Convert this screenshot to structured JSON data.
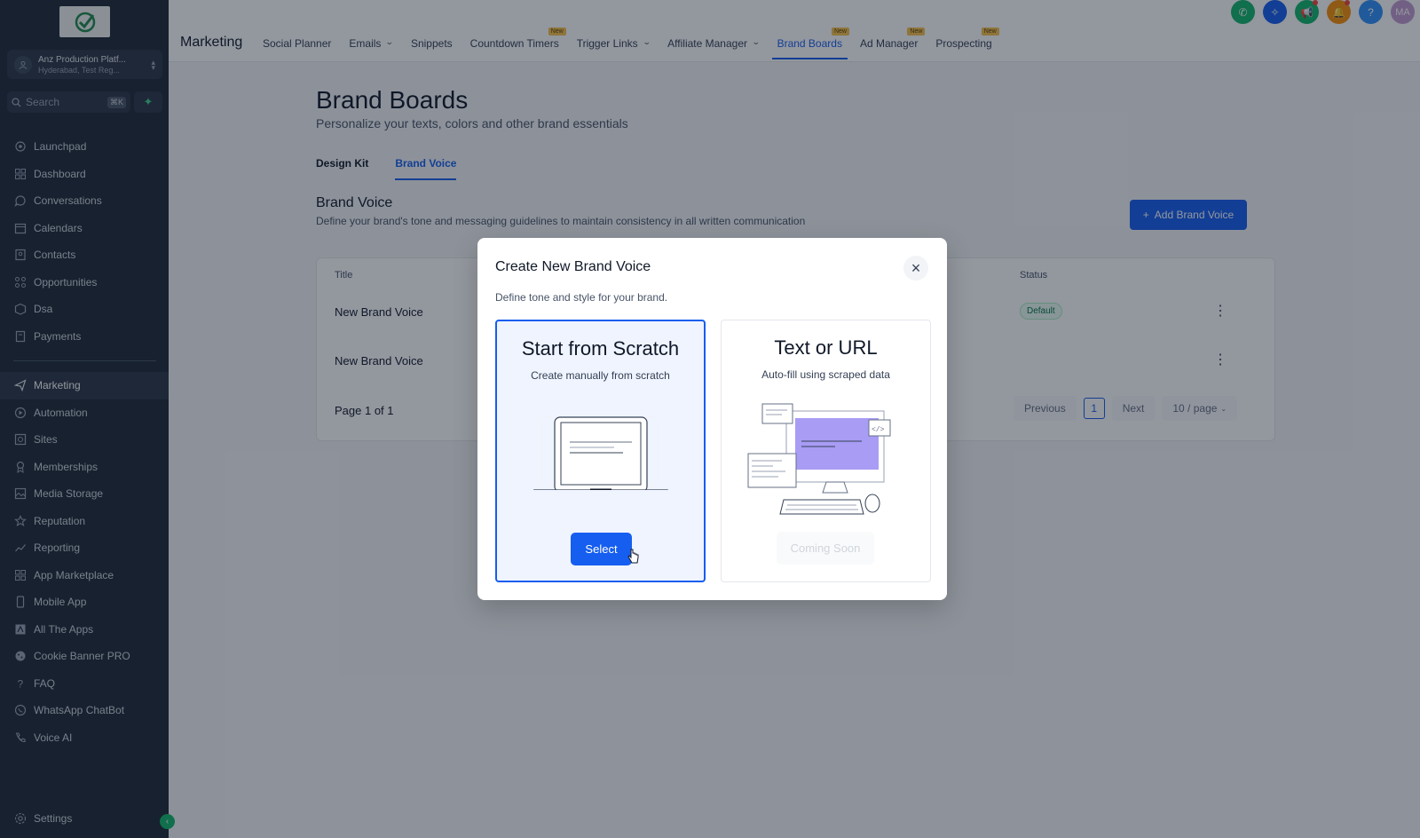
{
  "sidebar": {
    "account": {
      "name": "Anz Production Platf...",
      "location": "Hyderabad, Test Reg..."
    },
    "search": {
      "placeholder": "Search",
      "shortcut": "⌘K"
    },
    "items": [
      {
        "label": "Launchpad",
        "icon": "rocket-icon"
      },
      {
        "label": "Dashboard",
        "icon": "grid-icon"
      },
      {
        "label": "Conversations",
        "icon": "chat-icon"
      },
      {
        "label": "Calendars",
        "icon": "calendar-icon"
      },
      {
        "label": "Contacts",
        "icon": "contacts-icon"
      },
      {
        "label": "Opportunities",
        "icon": "opportunities-icon"
      },
      {
        "label": "Dsa",
        "icon": "box-icon"
      },
      {
        "label": "Payments",
        "icon": "payments-icon"
      }
    ],
    "items2": [
      {
        "label": "Marketing",
        "icon": "send-icon",
        "active": true
      },
      {
        "label": "Automation",
        "icon": "automation-icon"
      },
      {
        "label": "Sites",
        "icon": "sites-icon"
      },
      {
        "label": "Memberships",
        "icon": "memberships-icon"
      },
      {
        "label": "Media Storage",
        "icon": "image-icon"
      },
      {
        "label": "Reputation",
        "icon": "star-icon"
      },
      {
        "label": "Reporting",
        "icon": "chart-icon"
      },
      {
        "label": "App Marketplace",
        "icon": "apps-icon"
      },
      {
        "label": "Mobile App",
        "icon": "mobile-icon"
      },
      {
        "label": "All The Apps",
        "icon": "allapps-icon"
      },
      {
        "label": "Cookie Banner PRO",
        "icon": "cookie-icon"
      },
      {
        "label": "FAQ",
        "icon": "question-icon"
      },
      {
        "label": "WhatsApp ChatBot",
        "icon": "whatsapp-icon"
      },
      {
        "label": "Voice AI",
        "icon": "phone-icon"
      }
    ],
    "settings_label": "Settings"
  },
  "topbar": {
    "title": "Marketing",
    "tabs": [
      {
        "label": "Social Planner"
      },
      {
        "label": "Emails",
        "dropdown": true
      },
      {
        "label": "Snippets"
      },
      {
        "label": "Countdown Timers",
        "badge": "New"
      },
      {
        "label": "Trigger Links",
        "dropdown": true
      },
      {
        "label": "Affiliate Manager",
        "dropdown": true
      },
      {
        "label": "Brand Boards",
        "badge": "New",
        "active": true
      },
      {
        "label": "Ad Manager",
        "badge": "New"
      },
      {
        "label": "Prospecting",
        "badge": "New"
      }
    ],
    "icons": [
      {
        "name": "phone-icon",
        "color": "#12b76a"
      },
      {
        "name": "ai-sparkle-icon",
        "color": "#155eef"
      },
      {
        "name": "megaphone-icon",
        "color": "#12b76a"
      },
      {
        "name": "bell-icon",
        "color": "#f79009"
      },
      {
        "name": "help-icon",
        "color": "#2e90fa"
      }
    ],
    "avatar_initials": "MA"
  },
  "page": {
    "title": "Brand Boards",
    "subtitle": "Personalize your texts, colors and other brand essentials",
    "tabs": [
      {
        "label": "Design Kit"
      },
      {
        "label": "Brand Voice",
        "active": true
      }
    ],
    "section_title": "Brand Voice",
    "section_subtitle": "Define your brand's tone and messaging guidelines to maintain consistency in all written communication",
    "add_button": "Add Brand Voice",
    "table": {
      "col_title": "Title",
      "col_status": "Status",
      "rows": [
        {
          "title": "New Brand Voice",
          "status": "Default"
        },
        {
          "title": "New Brand Voice",
          "status": ""
        }
      ],
      "page_text": "Page 1 of 1",
      "previous": "Previous",
      "current_page": "1",
      "next": "Next",
      "page_size": "10 / page"
    }
  },
  "modal": {
    "title": "Create New Brand Voice",
    "subtitle": "Define tone and style for your brand.",
    "options": [
      {
        "title": "Start from Scratch",
        "description": "Create manually from scratch",
        "button": "Select"
      },
      {
        "title": "Text or URL",
        "description": "Auto-fill using scraped data",
        "button": "Coming Soon"
      }
    ]
  },
  "colors": {
    "accent": "#155eef",
    "sidebar_bg": "#1e2836",
    "success": "#12b76a"
  }
}
